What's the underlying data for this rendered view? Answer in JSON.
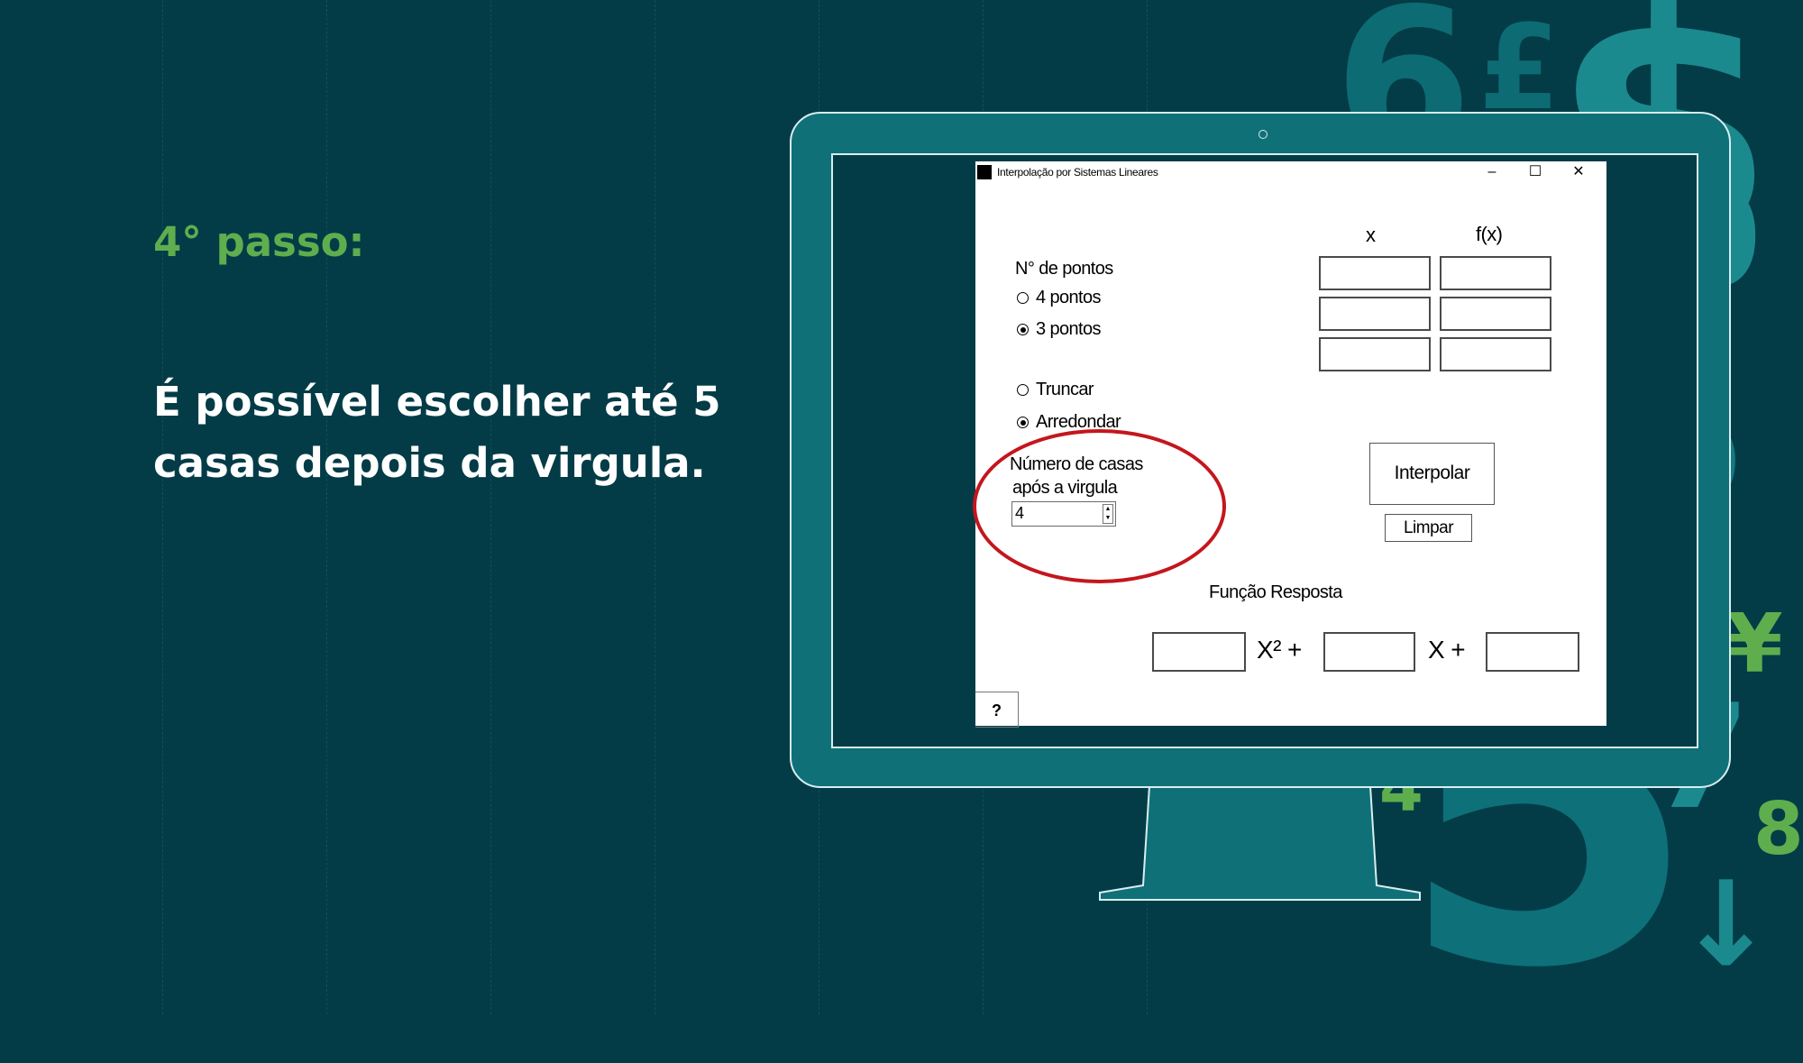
{
  "slide": {
    "step_title": "4° passo:",
    "step_text": "É possível escolher até 5 casas depois da virgula."
  },
  "background_glyphs": [
    {
      "char": "6",
      "color": "#0d6b73"
    },
    {
      "char": "£",
      "color": "#0d6b73"
    },
    {
      "char": "$",
      "color": "#1b8a8f"
    },
    {
      "char": "0",
      "color": "#1b8a8f"
    },
    {
      "char": "9",
      "color": "#0d6b73"
    },
    {
      "char": "3",
      "color": "#127a82"
    },
    {
      "char": "5",
      "color": "#0e7078"
    },
    {
      "char": "¥",
      "color": "#5fae4e"
    },
    {
      "char": "7",
      "color": "#1b8a8f"
    },
    {
      "char": "8",
      "color": "#5fae4e"
    },
    {
      "char": "4",
      "color": "#5fae4e"
    },
    {
      "char": "↓",
      "color": "#1b8a8f"
    }
  ],
  "window": {
    "title": "Interpolação por Sistemas Lineares",
    "minimize": "–",
    "maximize": "☐",
    "close": "✕",
    "points_label": "N° de pontos",
    "radio_4": "4 pontos",
    "radio_3": "3 pontos",
    "radio_truncar": "Truncar",
    "radio_arredondar": "Arredondar",
    "selected_points": "3 pontos",
    "selected_mode": "Arredondar",
    "decimals_label_1": "Número de casas",
    "decimals_label_2": "após a virgula",
    "decimals_value": "4",
    "col_x": "x",
    "col_fx": "f(x)",
    "interpolar": "Interpolar",
    "limpar": "Limpar",
    "function_label": "Função Resposta",
    "x2_term": "X² +",
    "x_term": "X +",
    "help": "?"
  },
  "colors": {
    "background": "#033c47",
    "accent_green": "#5fae4e",
    "monitor": "#0f7078",
    "highlight_red": "#c4161c"
  }
}
